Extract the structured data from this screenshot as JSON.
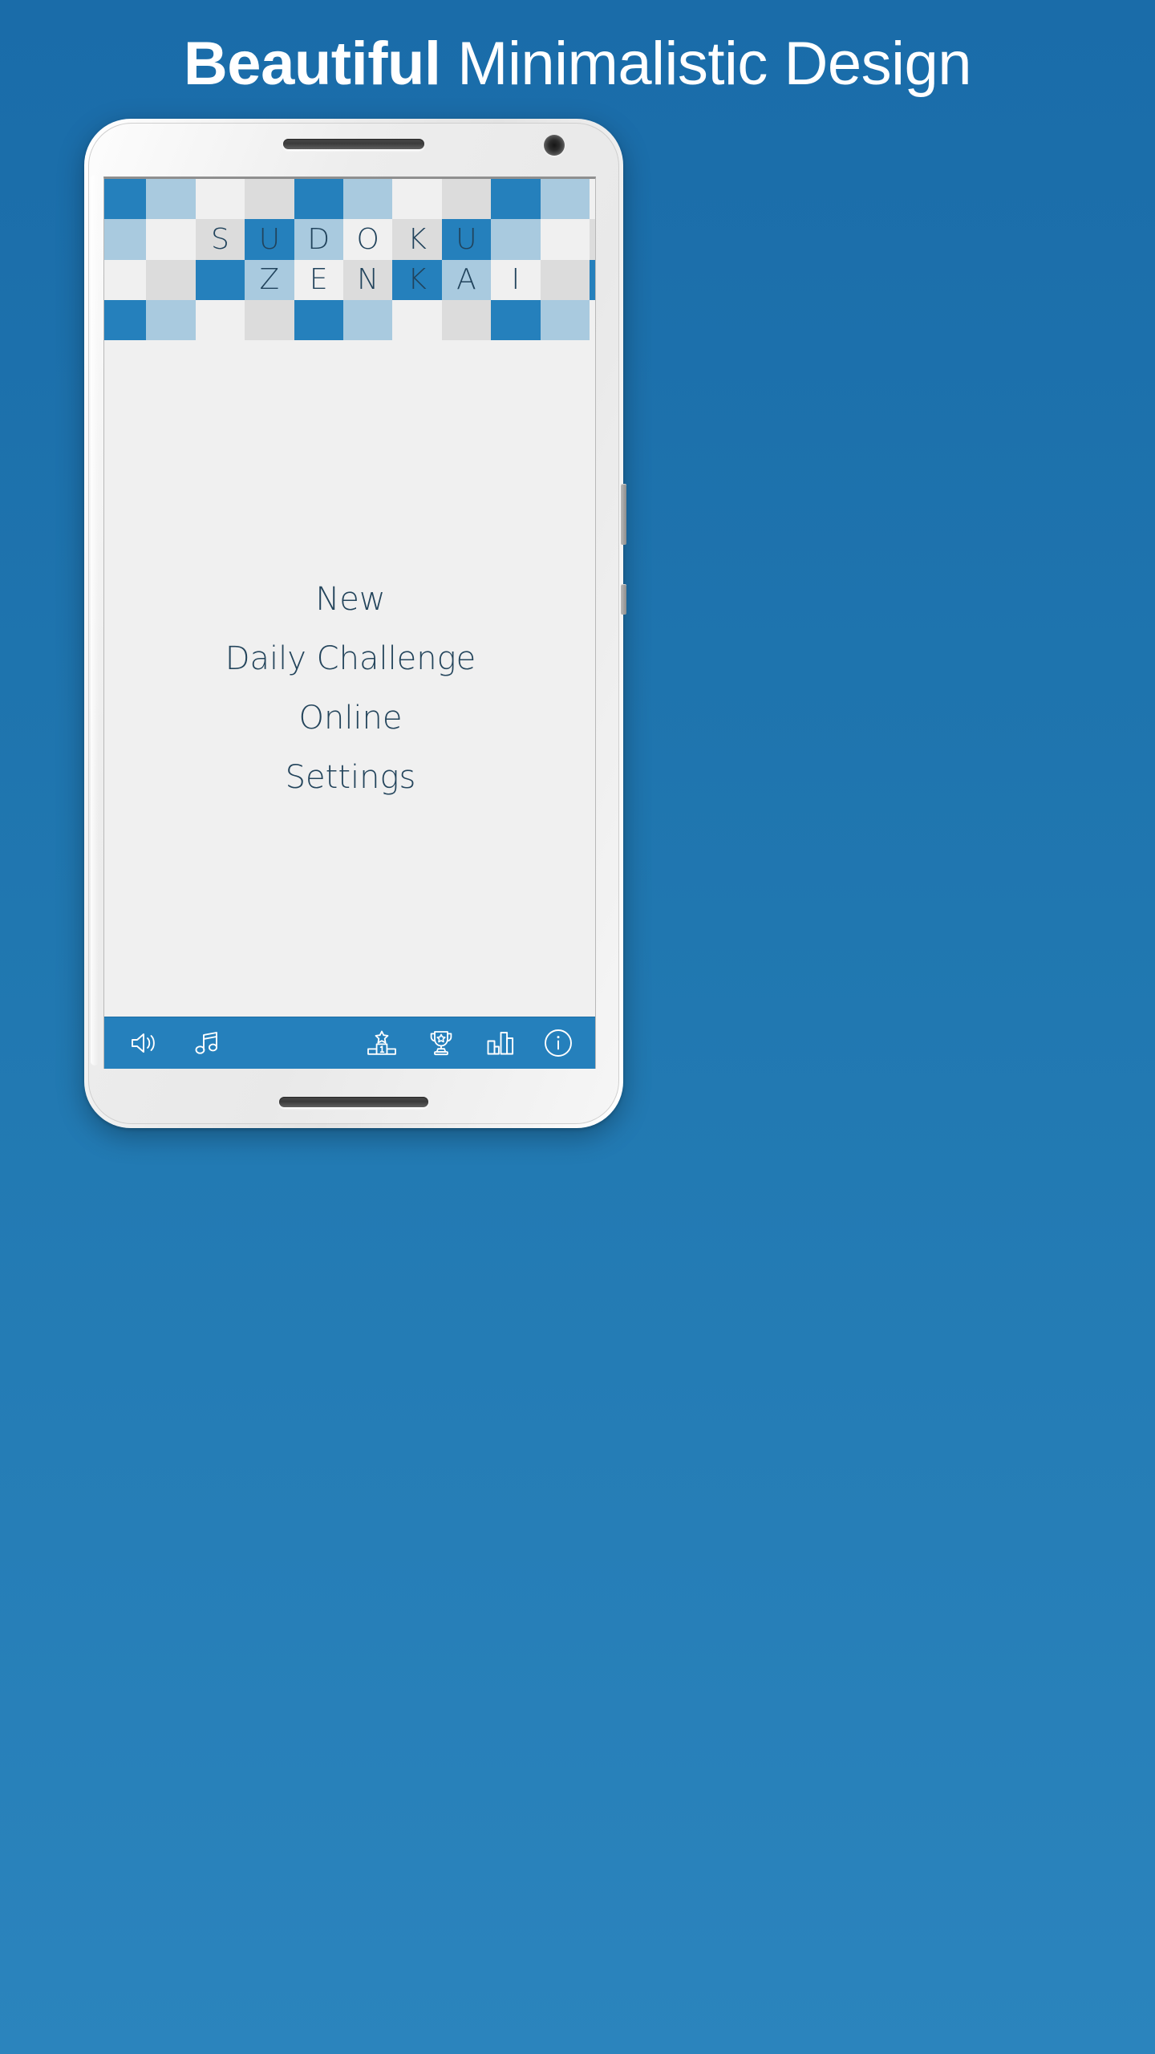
{
  "headline": {
    "bold_part": "Beautiful",
    "light_part": "Minimalistic Design"
  },
  "colors": {
    "background_top": "#1a6ca9",
    "background_bottom": "#2b84bd",
    "accent_blue": "#2580bc",
    "tile_light_blue": "#a9cadf",
    "tile_gray": "#dcdcdc",
    "tile_white": "#f0f0f0",
    "text_navy": "#24455c",
    "screen_background": "#f0f0f0"
  },
  "device": {
    "speaker_top": "top-speaker-grille",
    "speaker_bottom": "bottom-speaker-grille",
    "camera": "front-camera",
    "buttons": [
      "volume-rocker",
      "power-button"
    ]
  },
  "logo": {
    "line_one": "SUDOKU",
    "line_two": "ZENKAI",
    "grid": [
      [
        "dark",
        "light",
        "white",
        "gray",
        "dark",
        "light",
        "white",
        "gray",
        "dark",
        "light"
      ],
      [
        "light",
        "white",
        "gray",
        "dark",
        "light",
        "white",
        "gray",
        "dark",
        "light",
        "white"
      ],
      [
        "white",
        "gray",
        "dark",
        "light",
        "white",
        "gray",
        "dark",
        "light",
        "white",
        "gray"
      ],
      [
        "dark",
        "light",
        "white",
        "gray",
        "dark",
        "light",
        "white",
        "gray",
        "dark",
        "light"
      ]
    ],
    "letters_row_two": [
      "",
      "",
      "S",
      "U",
      "D",
      "O",
      "K",
      "U",
      "",
      ""
    ],
    "letters_row_three": [
      "",
      "",
      "",
      "Z",
      "E",
      "N",
      "K",
      "A",
      "I",
      ""
    ]
  },
  "menu": {
    "items": [
      {
        "label": "New",
        "name": "new"
      },
      {
        "label": "Daily Challenge",
        "name": "daily-challenge"
      },
      {
        "label": "Online",
        "name": "online"
      },
      {
        "label": "Settings",
        "name": "settings"
      }
    ]
  },
  "toolbar": {
    "items": [
      {
        "name": "sound-icon",
        "label": "Sound"
      },
      {
        "name": "music-icon",
        "label": "Music"
      },
      {
        "name": "leaderboard-icon",
        "label": "Leaderboard"
      },
      {
        "name": "trophy-icon",
        "label": "Achievements"
      },
      {
        "name": "statistics-icon",
        "label": "Statistics"
      },
      {
        "name": "info-icon",
        "label": "Info"
      }
    ],
    "leaderboard_rank": "1"
  }
}
